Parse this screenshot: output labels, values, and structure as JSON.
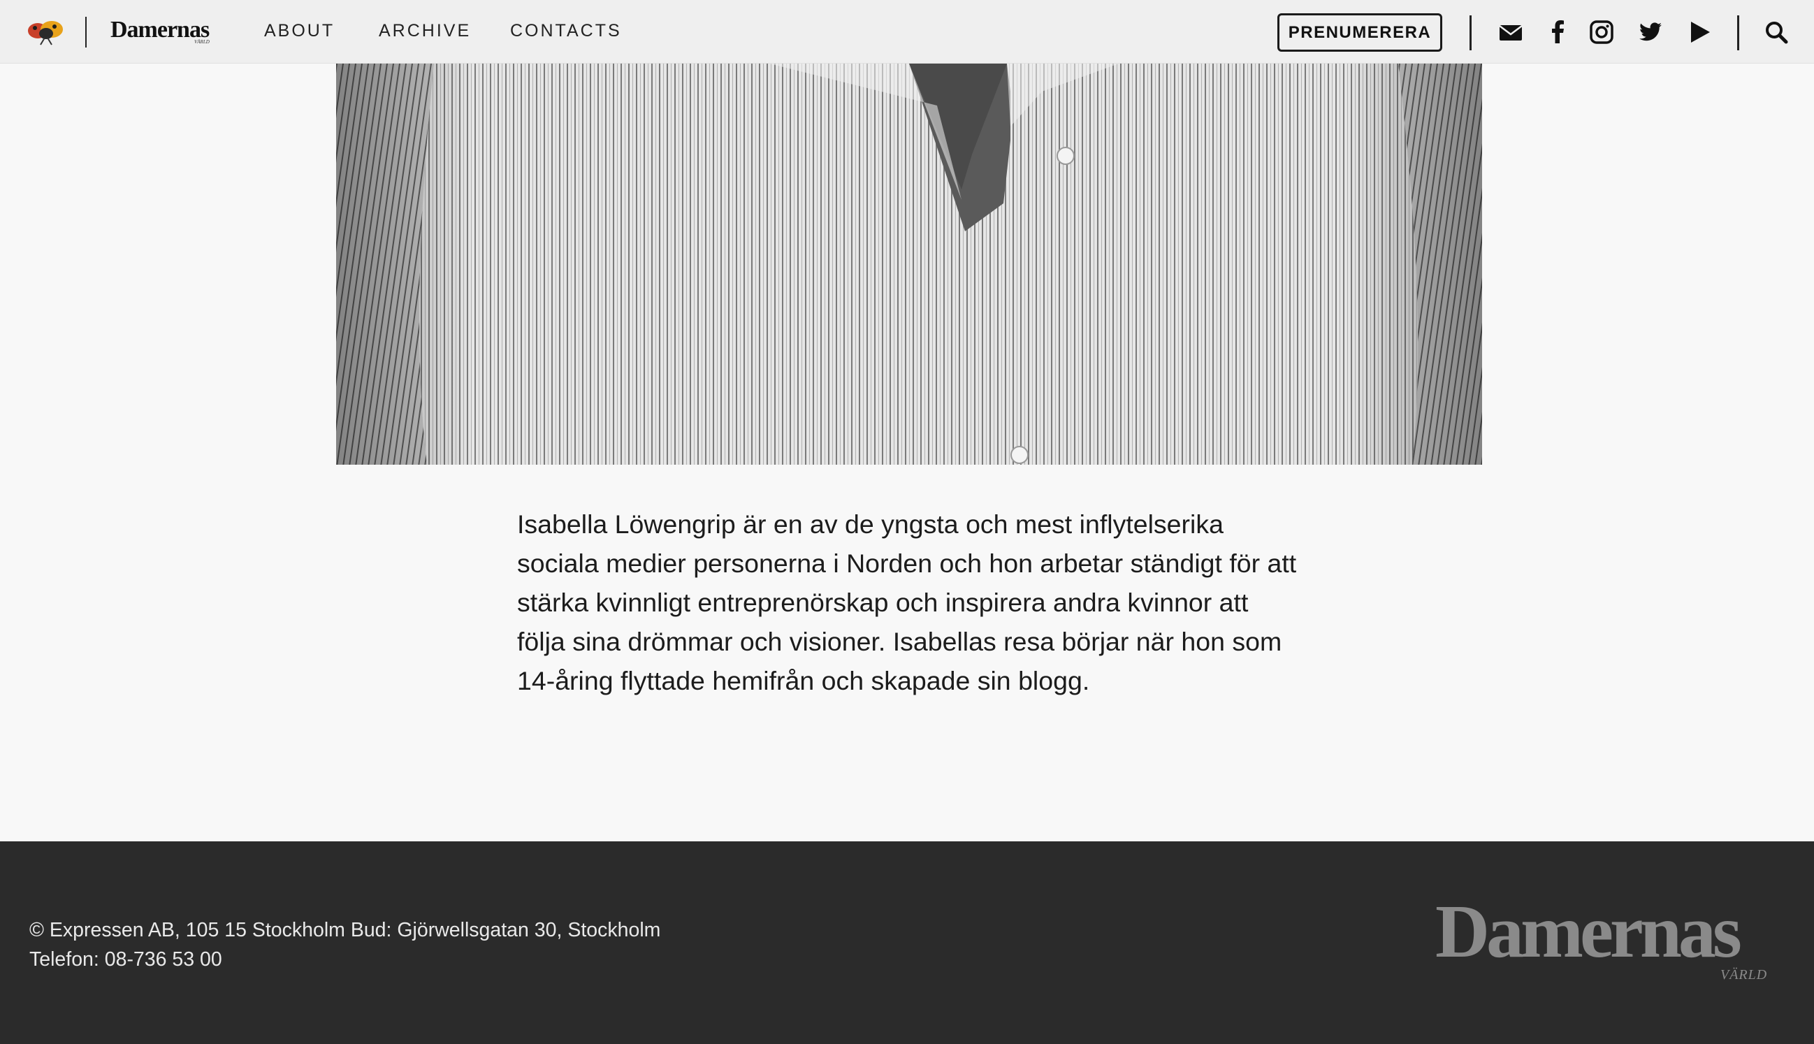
{
  "header": {
    "brand": "Damernas",
    "brand_sub": "VÄRLD",
    "nav": [
      "ABOUT",
      "ARCHIVE",
      "CONTACTS"
    ],
    "subscribe_label": "PRENUMERERA",
    "icons": [
      "logo-mark-icon",
      "mail-icon",
      "facebook-icon",
      "instagram-icon",
      "twitter-icon",
      "youtube-play-icon",
      "search-icon"
    ]
  },
  "article": {
    "body": "Isabella Löwengrip är en av de yngsta och mest inflytelserika sociala medier personerna i Norden och hon arbetar ständigt för att stärka kvinnligt entreprenörskap och inspirera andra kvinnor att följa sina drömmar och visioner. Isabellas resa börjar när hon som 14-åring flyttade hemifrån och skapade sin blogg."
  },
  "footer": {
    "address": "© Expressen AB, 105 15 Stockholm Bud: Gjörwellsgatan 30, Stockholm",
    "phone": "Telefon: 08-736 53 00",
    "logo": "Damernas",
    "logo_sub": "VÄRLD"
  },
  "colors": {
    "header_bg": "#efefef",
    "page_bg": "#f8f8f8",
    "footer_bg": "#2b2b2b",
    "footer_text": "#e9e9e9",
    "footer_logo": "#8a8a8a"
  }
}
